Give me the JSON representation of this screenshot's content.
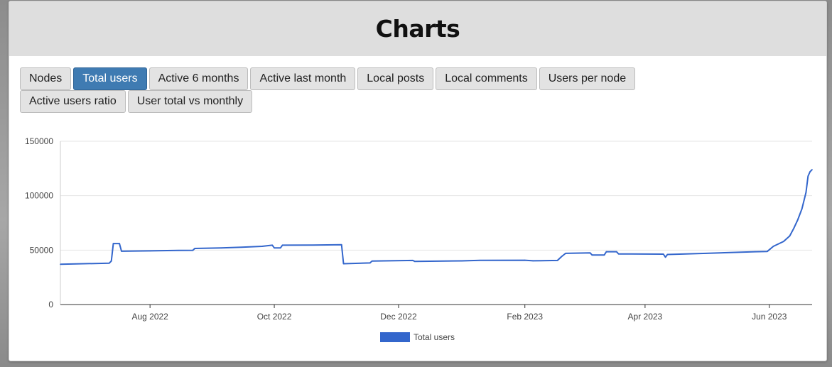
{
  "header": {
    "title": "Charts"
  },
  "tabs": [
    {
      "label": "Nodes",
      "active": false
    },
    {
      "label": "Total users",
      "active": true
    },
    {
      "label": "Active 6 months",
      "active": false
    },
    {
      "label": "Active last month",
      "active": false
    },
    {
      "label": "Local posts",
      "active": false
    },
    {
      "label": "Local comments",
      "active": false
    },
    {
      "label": "Users per node",
      "active": false
    },
    {
      "label": "Active users ratio",
      "active": false
    },
    {
      "label": "User total vs monthly",
      "active": false
    }
  ],
  "colors": {
    "accent": "#3f7bb2",
    "series": "#3366cc",
    "header_bg": "#dedede"
  },
  "chart_data": {
    "type": "line",
    "title": "",
    "xlabel": "",
    "ylabel": "",
    "ylim": [
      0,
      150000
    ],
    "yticks": [
      0,
      50000,
      100000,
      150000
    ],
    "ytick_labels": [
      "0",
      "50000",
      "100000",
      "150000"
    ],
    "xlim": [
      "2022-06-18",
      "2023-06-22"
    ],
    "xticks": [
      "2022-08-01",
      "2022-10-01",
      "2022-12-01",
      "2023-02-01",
      "2023-04-01",
      "2023-06-01"
    ],
    "xtick_labels": [
      "Aug 2022",
      "Oct 2022",
      "Dec 2022",
      "Feb 2023",
      "Apr 2023",
      "Jun 2023"
    ],
    "grid": true,
    "legend": "bottom",
    "series": [
      {
        "name": "Total users",
        "points": [
          [
            "2022-06-18",
            37000
          ],
          [
            "2022-07-12",
            38000
          ],
          [
            "2022-07-13",
            40000
          ],
          [
            "2022-07-14",
            56000
          ],
          [
            "2022-07-17",
            56000
          ],
          [
            "2022-07-18",
            49000
          ],
          [
            "2022-08-01",
            49300
          ],
          [
            "2022-08-15",
            49700
          ],
          [
            "2022-08-22",
            49800
          ],
          [
            "2022-08-23",
            51500
          ],
          [
            "2022-09-05",
            52000
          ],
          [
            "2022-09-15",
            52600
          ],
          [
            "2022-09-25",
            53500
          ],
          [
            "2022-09-30",
            54500
          ],
          [
            "2022-10-01",
            52000
          ],
          [
            "2022-10-04",
            52000
          ],
          [
            "2022-10-05",
            54500
          ],
          [
            "2022-10-20",
            54600
          ],
          [
            "2022-11-03",
            55000
          ],
          [
            "2022-11-04",
            37500
          ],
          [
            "2022-11-17",
            38200
          ],
          [
            "2022-11-18",
            40000
          ],
          [
            "2022-12-08",
            40500
          ],
          [
            "2022-12-09",
            39600
          ],
          [
            "2023-01-01",
            40100
          ],
          [
            "2023-01-10",
            40600
          ],
          [
            "2023-02-01",
            40700
          ],
          [
            "2023-02-05",
            40200
          ],
          [
            "2023-02-17",
            40500
          ],
          [
            "2023-02-19",
            44000
          ],
          [
            "2023-02-21",
            47000
          ],
          [
            "2023-03-05",
            47500
          ],
          [
            "2023-03-06",
            45500
          ],
          [
            "2023-03-12",
            45500
          ],
          [
            "2023-03-13",
            48500
          ],
          [
            "2023-03-18",
            48500
          ],
          [
            "2023-03-19",
            46500
          ],
          [
            "2023-04-10",
            46300
          ],
          [
            "2023-04-11",
            43500
          ],
          [
            "2023-04-12",
            46000
          ],
          [
            "2023-05-01",
            47000
          ],
          [
            "2023-05-25",
            48500
          ],
          [
            "2023-05-31",
            48800
          ],
          [
            "2023-06-03",
            53500
          ],
          [
            "2023-06-08",
            58000
          ],
          [
            "2023-06-11",
            63000
          ],
          [
            "2023-06-13",
            70000
          ],
          [
            "2023-06-15",
            78000
          ],
          [
            "2023-06-17",
            88000
          ],
          [
            "2023-06-19",
            103000
          ],
          [
            "2023-06-20",
            118000
          ],
          [
            "2023-06-21",
            122000
          ],
          [
            "2023-06-22",
            124000
          ]
        ]
      }
    ]
  }
}
